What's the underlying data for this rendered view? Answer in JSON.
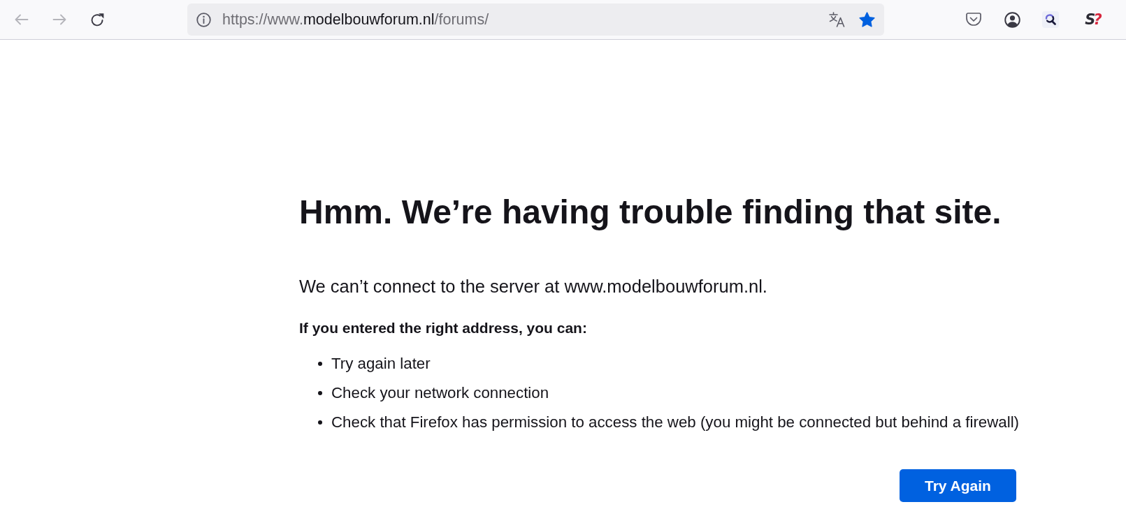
{
  "toolbar": {
    "nav_buttons": [
      {
        "kind": "back",
        "disabled": true
      },
      {
        "kind": "forward",
        "disabled": true
      },
      {
        "kind": "reload",
        "disabled": false
      }
    ],
    "address": {
      "scheme": "https://www.",
      "domain": "modelbouwforum.nl",
      "path": "/forums/",
      "bookmarked": true
    },
    "extensions": [
      {
        "kind": "shield"
      },
      {
        "kind": "account"
      },
      {
        "kind": "magnifier"
      },
      {
        "kind": "logo",
        "letter": "S",
        "mark": "?"
      }
    ]
  },
  "error": {
    "title": "Hmm. We’re having trouble finding that site.",
    "description": "We can’t connect to the server at www.modelbouwforum.nl.",
    "suggestions_heading": "If you entered the right address, you can:",
    "suggestions": [
      "Try again later",
      "Check your network connection",
      "Check that Firefox has permission to access the web (you might be connected but behind a firewall)"
    ],
    "button": "Try Again"
  }
}
